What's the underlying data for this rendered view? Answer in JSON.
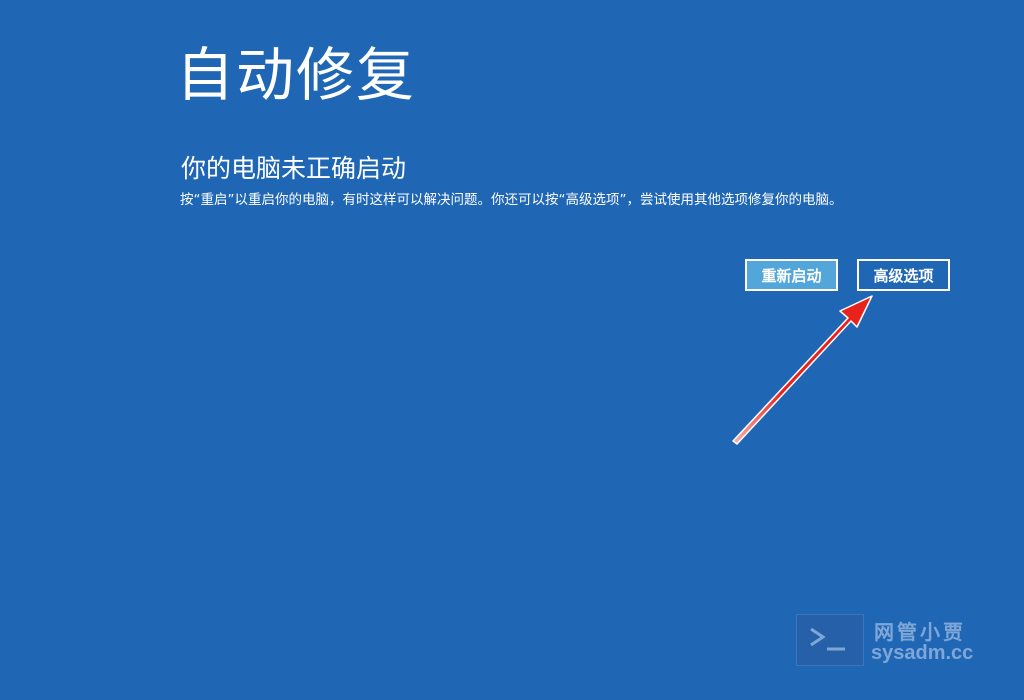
{
  "screen": {
    "title": "自动修复",
    "subtitle": "你的电脑未正确启动",
    "description": "按“重启”以重启你的电脑，有时这样可以解决问题。你还可以按“高级选项”，尝试使用其他选项修复你的电脑。"
  },
  "buttons": {
    "restart_label": "重新启动",
    "advanced_label": "高级选项"
  },
  "watermark": {
    "name": "网管小贾",
    "domain": "sysadm.cc",
    "icon": "terminal-icon"
  },
  "annotation": {
    "icon": "red-arrow-icon",
    "color": "#e8231b"
  },
  "colors": {
    "background": "#1f66b4",
    "restart_button": "#52a6d9"
  }
}
